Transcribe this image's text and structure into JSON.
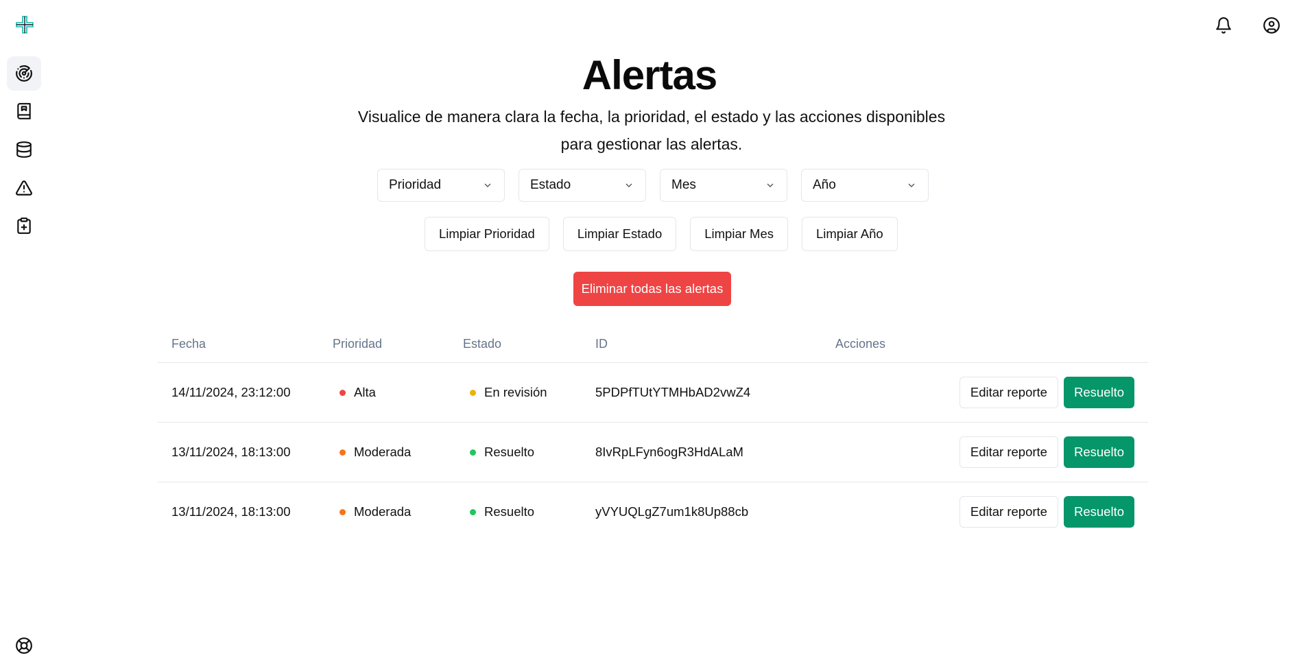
{
  "colors": {
    "accent": "#14b8a6",
    "danger": "#ef4444",
    "success": "#059669",
    "priority_alta": "#ef4444",
    "priority_moderada": "#f97316",
    "status_revision": "#eab308",
    "status_resuelto": "#22c55e"
  },
  "sidebar": {
    "logo_icon": "plus-cross-logo",
    "items": [
      {
        "icon": "radar-icon",
        "active": true
      },
      {
        "icon": "book-icon",
        "active": false
      },
      {
        "icon": "database-icon",
        "active": false
      },
      {
        "icon": "warning-icon",
        "active": false
      },
      {
        "icon": "clipboard-plus-icon",
        "active": false
      }
    ],
    "bottom_icon": "lifebuoy-icon"
  },
  "header": {
    "notification_icon": "bell-icon",
    "user_icon": "user-circle-icon"
  },
  "page": {
    "title": "Alertas",
    "subtitle": "Visualice de manera clara la fecha, la prioridad, el estado y las acciones disponibles para gestionar las alertas."
  },
  "filters": {
    "priority": "Prioridad",
    "status": "Estado",
    "month": "Mes",
    "year": "Año"
  },
  "clear_buttons": {
    "priority": "Limpiar Prioridad",
    "status": "Limpiar Estado",
    "month": "Limpiar Mes",
    "year": "Limpiar Año"
  },
  "delete_all_label": "Eliminar todas las alertas",
  "table": {
    "headers": {
      "date": "Fecha",
      "priority": "Prioridad",
      "status": "Estado",
      "id": "ID",
      "actions": "Acciones"
    },
    "rows": [
      {
        "date": "14/11/2024, 23:12:00",
        "priority": "Alta",
        "status": "En revisión",
        "id": "5PDPfTUtYTMHbAD2vwZ4",
        "edit_label": "Editar reporte",
        "resolve_label": "Resuelto"
      },
      {
        "date": "13/11/2024, 18:13:00",
        "priority": "Moderada",
        "status": "Resuelto",
        "id": "8IvRpLFyn6ogR3HdALaM",
        "edit_label": "Editar reporte",
        "resolve_label": "Resuelto"
      },
      {
        "date": "13/11/2024, 18:13:00",
        "priority": "Moderada",
        "status": "Resuelto",
        "id": "yVYUQLgZ7um1k8Up88cb",
        "edit_label": "Editar reporte",
        "resolve_label": "Resuelto"
      }
    ]
  }
}
